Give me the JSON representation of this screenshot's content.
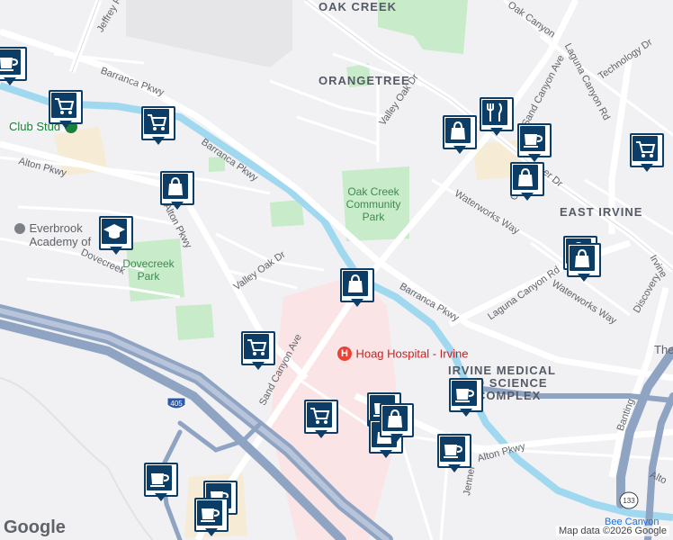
{
  "areas": {
    "oak_creek": "OAK CREEK",
    "orangetree": "ORANGETREE",
    "east_irvine": "EAST IRVINE",
    "irvine_medical_1": "IRVINE MEDICAL",
    "irvine_medical_2": "AND SCIENCE",
    "irvine_medical_3": "COMPLEX",
    "the_partial": "The"
  },
  "streets": {
    "jeffrey": "Jeffrey R",
    "barranca_top": "Barranca Pkwy",
    "barranca_mid": "Barranca Pkwy",
    "barranca_right": "Barranca Pkwy",
    "alton_left": "Alton Pkwy",
    "alton_mid": "Alton Pkwy",
    "alton_right": "Alton Pkwy",
    "alton_far": "Alto",
    "valley_oak_top": "Valley Oak Dr",
    "valley_oak_bottom": "Valley Oak Dr",
    "oak_canyon": "Oak Canyon",
    "sand_canyon_top": "Sand Canyon Ave",
    "sand_canyon_bottom": "Sand Canyon Ave",
    "laguna_canyon_top": "Laguna Canyon Rd",
    "laguna_canyon_bottom": "Laguna Canyon Rd",
    "technology": "Technology Dr",
    "waterworks_1": "Waterworks Way",
    "waterworks_2": "Waterworks Way",
    "dovecreek": "Dovecreek",
    "discovery": "Discovery",
    "irvine_partial": "Irvine",
    "banting": "Banting",
    "jenner": "Jenner",
    "oak_partial": "O",
    "er_dr": "er Dr",
    "d_partial": "D"
  },
  "parks": {
    "oak_creek_park": [
      "Oak Creek",
      "Community",
      "Park"
    ],
    "dovecreek_park": [
      "Dovecreek",
      "Park"
    ]
  },
  "pois": {
    "hoag": "Hoag Hospital - Irvine",
    "club": "Club Stud",
    "everbrook_1": "Everbrook",
    "everbrook_2": "Academy of",
    "bee_canyon": "Bee Canyon"
  },
  "shields": {
    "i405": "405",
    "r133": "133"
  },
  "attribution": {
    "logo": "Google",
    "text": "Map data ©2026 Google"
  },
  "colors": {
    "pin": "#0b3d66",
    "park": "#c8ebc9",
    "water": "#9fd8ef",
    "hospital": "#fbe4e6",
    "highway": "#8fa3c3",
    "campus": "#f6ecd6"
  },
  "markers": [
    {
      "type": "cart-icon"
    },
    {
      "type": "cart-icon"
    },
    {
      "type": "bag-icon"
    },
    {
      "type": "school-icon"
    },
    {
      "type": "coffee-icon"
    },
    {
      "type": "bag-icon"
    },
    {
      "type": "fork-knife-icon"
    },
    {
      "type": "coffee-icon"
    },
    {
      "type": "bag-icon"
    },
    {
      "type": "cart-icon"
    },
    {
      "type": "bag-icon"
    },
    {
      "type": "bag-icon"
    },
    {
      "type": "bag-icon"
    },
    {
      "type": "cart-icon"
    },
    {
      "type": "coffee-icon"
    },
    {
      "type": "bag-icon"
    },
    {
      "type": "coffee-icon"
    },
    {
      "type": "bag-icon"
    },
    {
      "type": "coffee-icon"
    },
    {
      "type": "cart-icon"
    },
    {
      "type": "coffee-icon"
    },
    {
      "type": "coffee-icon"
    },
    {
      "type": "coffee-icon"
    }
  ]
}
